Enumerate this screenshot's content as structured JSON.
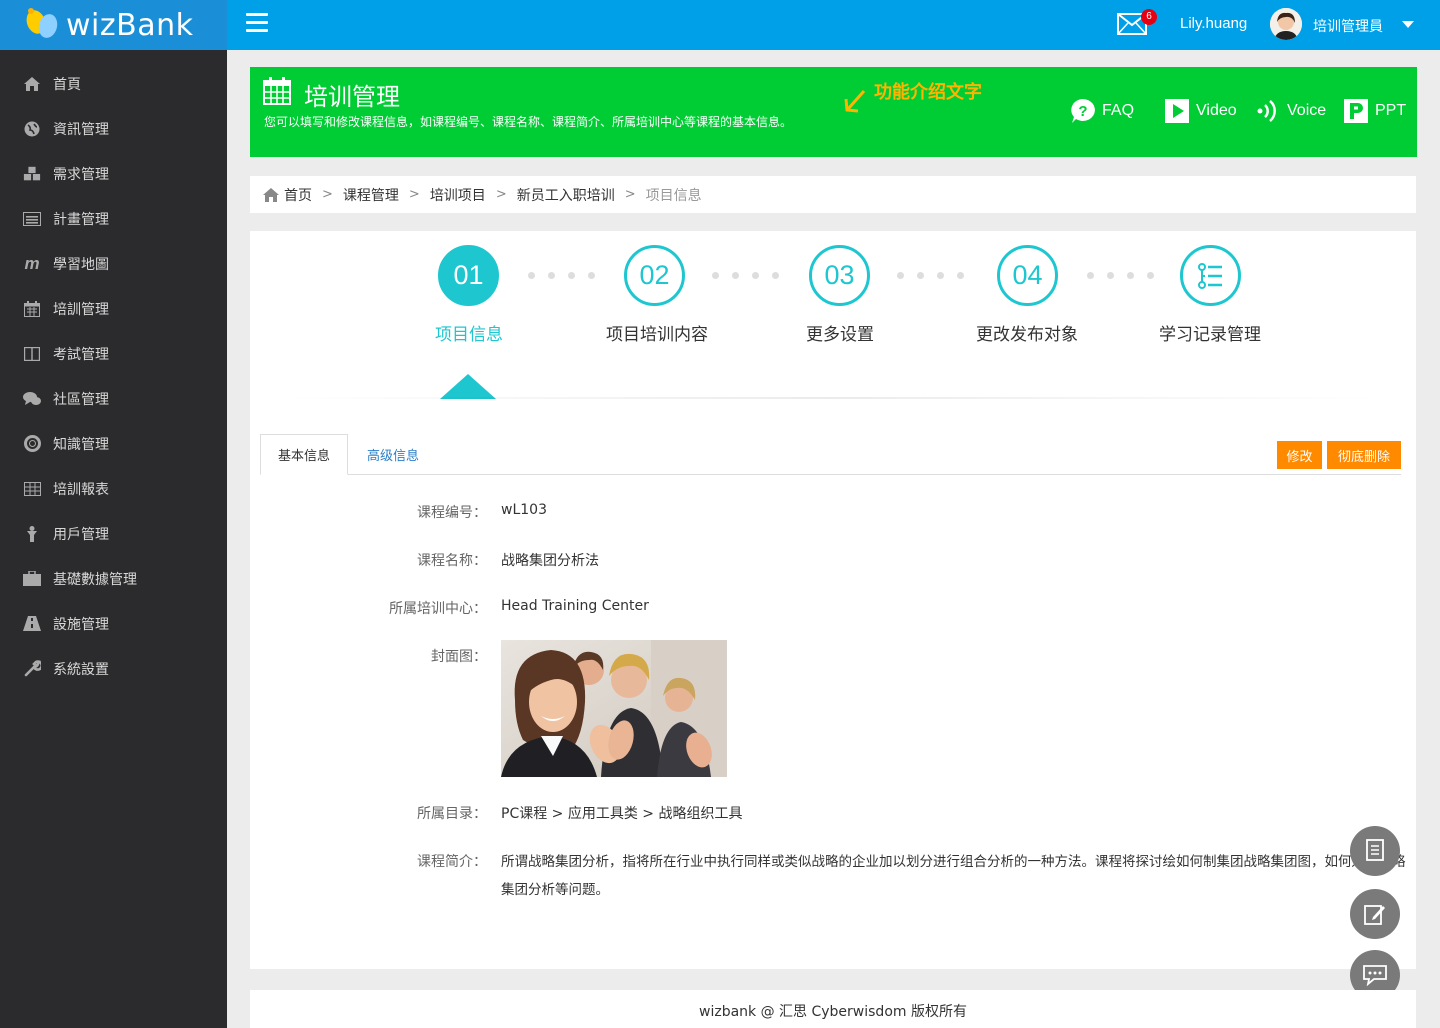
{
  "app": {
    "logo_text": "wizBank",
    "user_name": "Lily.huang",
    "role": "培训管理員",
    "mail_count": "6"
  },
  "sidebar": {
    "items": [
      {
        "label": "首頁",
        "icon": "home-icon"
      },
      {
        "label": "資訊管理",
        "icon": "globe-icon"
      },
      {
        "label": "需求管理",
        "icon": "cubes-icon"
      },
      {
        "label": "計畫管理",
        "icon": "list-icon"
      },
      {
        "label": "學習地圖",
        "icon": "map-m-icon"
      },
      {
        "label": "培訓管理",
        "icon": "calendar-icon"
      },
      {
        "label": "考試管理",
        "icon": "book-icon"
      },
      {
        "label": "社區管理",
        "icon": "comments-icon"
      },
      {
        "label": "知識管理",
        "icon": "lifebuoy-icon"
      },
      {
        "label": "培訓報表",
        "icon": "table-icon"
      },
      {
        "label": "用戶管理",
        "icon": "user-icon"
      },
      {
        "label": "基礎數據管理",
        "icon": "briefcase-icon"
      },
      {
        "label": "設施管理",
        "icon": "road-icon"
      },
      {
        "label": "系統設置",
        "icon": "wrench-icon"
      }
    ]
  },
  "banner": {
    "title": "培训管理",
    "description": "您可以填写和修改课程信息，如课程编号、课程名称、课程简介、所属培训中心等课程的基本信息。",
    "feature_text": "功能介绍文字",
    "links": [
      {
        "label": "FAQ",
        "icon": "question-bubble-icon"
      },
      {
        "label": "Video",
        "icon": "play-icon"
      },
      {
        "label": "Voice",
        "icon": "sound-wave-icon"
      },
      {
        "label": "PPT",
        "icon": "ppt-icon"
      }
    ],
    "colors": {
      "background": "#00cc33",
      "feature": "#ffb400"
    }
  },
  "breadcrumb": {
    "items": [
      "首页",
      "课程管理",
      "培训项目",
      "新员工入职培训"
    ],
    "current": "项目信息"
  },
  "steps": [
    {
      "number": "01",
      "label": "项目信息",
      "active": true
    },
    {
      "number": "02",
      "label": "项目培训内容",
      "active": false
    },
    {
      "number": "03",
      "label": "更多设置",
      "active": false
    },
    {
      "number": "04",
      "label": "更改发布对象",
      "active": false
    },
    {
      "number": "",
      "label": "学习记录管理",
      "active": false,
      "icon": "list-check-icon"
    }
  ],
  "tabs": [
    "基本信息",
    "高级信息"
  ],
  "actions": {
    "edit": "修改",
    "delete": "彻底删除"
  },
  "fields": {
    "code_label": "课程编号：",
    "code_value": "wL103",
    "name_label": "课程名称：",
    "name_value": "战略集团分析法",
    "center_label": "所属培训中心：",
    "center_value": "Head Training Center",
    "cover_label": "封面图：",
    "catalog_label": "所属目录：",
    "catalog_value": "PC课程 > 应用工具类 > 战略组织工具",
    "intro_label": "课程简介：",
    "intro_value": "所谓战略集团分析，指将所在行业中执行同样或类似战略的企业加以划分进行组合分析的一种方法。课程将探讨绘如何制集团战略集团图，如何进行战略集团分析等问题。"
  },
  "footer": {
    "text": "wizbank @ 汇思 Cyberwisdom 版权所有"
  },
  "accent_color": "#1ec7d0",
  "orange_color": "#ff8a00"
}
